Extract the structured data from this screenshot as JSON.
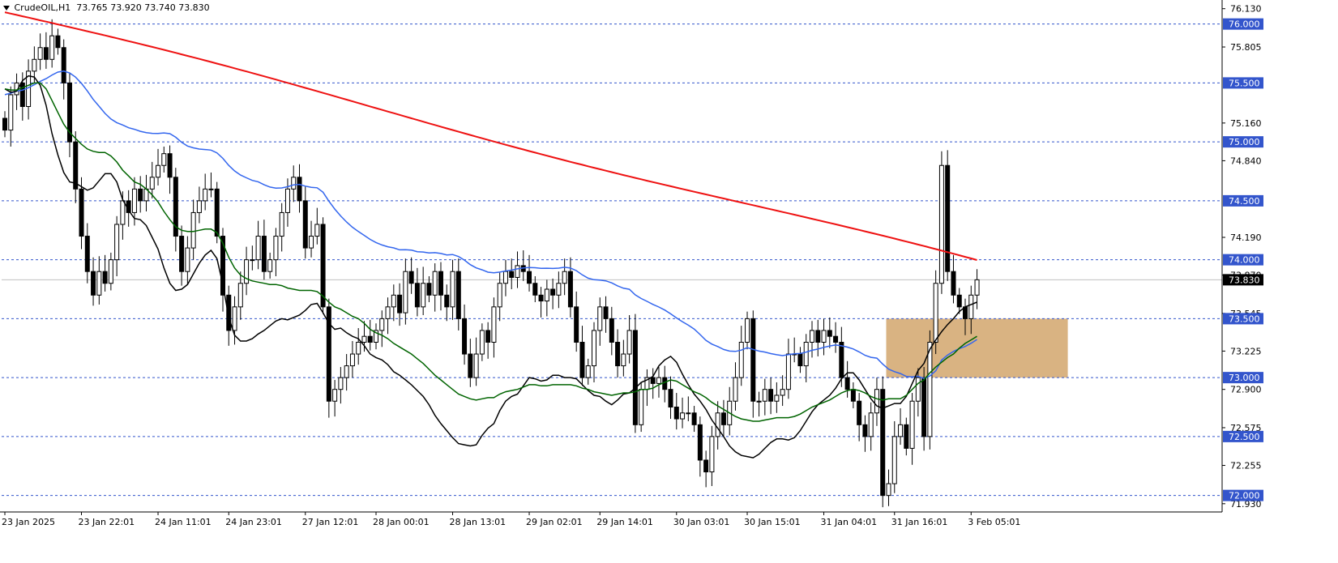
{
  "header": {
    "symbol": "CrudeOIL,H1",
    "ohlc": "73.765 73.920 73.740 73.830"
  },
  "colors": {
    "bull": "#ffffff",
    "bear": "#000000",
    "ma_fast": "#000000",
    "ma_mid": "#006400",
    "ma_slow": "#3366ee",
    "ma_long": "#ee1111",
    "level_line": "#3355cc",
    "level_badge": "#3355cc",
    "zone": "#d9b382",
    "price_line": "#c0c0c0"
  },
  "chart_data": {
    "type": "candlestick",
    "title": "",
    "xlabel": "",
    "ylabel": "",
    "ylim": [
      71.86,
      76.19
    ],
    "grid": false,
    "y_ticks": [
      "76.130",
      "75.805",
      "75.160",
      "74.840",
      "74.190",
      "73.870",
      "73.545",
      "73.225",
      "72.900",
      "72.575",
      "72.255",
      "71.930"
    ],
    "y_tick_values": [
      76.13,
      75.805,
      75.16,
      74.84,
      74.19,
      73.87,
      73.545,
      73.225,
      72.9,
      72.575,
      72.255,
      71.93
    ],
    "x_ticks": [
      "23 Jan 2025",
      "23 Jan 22:01",
      "24 Jan 11:01",
      "24 Jan 23:01",
      "27 Jan 12:01",
      "28 Jan 00:01",
      "28 Jan 13:01",
      "29 Jan 02:01",
      "29 Jan 14:01",
      "30 Jan 03:01",
      "30 Jan 15:01",
      "31 Jan 04:01",
      "31 Jan 16:01",
      "3 Feb 05:01"
    ],
    "x_tick_index": [
      0,
      13,
      26,
      38,
      51,
      63,
      76,
      89,
      101,
      114,
      126,
      139,
      151,
      164
    ],
    "levels": [
      {
        "label": "76.000",
        "value": 76.0
      },
      {
        "label": "75.500",
        "value": 75.5
      },
      {
        "label": "75.000",
        "value": 75.0
      },
      {
        "label": "74.500",
        "value": 74.5
      },
      {
        "label": "74.000",
        "value": 74.0
      },
      {
        "label": "73.500",
        "value": 73.5
      },
      {
        "label": "73.000",
        "value": 73.0
      },
      {
        "label": "72.500",
        "value": 72.5
      },
      {
        "label": "72.000",
        "value": 72.0
      }
    ],
    "current_price": {
      "label": "73.830",
      "value": 73.83
    },
    "zone": {
      "from_index": 150,
      "to_index": 180,
      "low": 73.0,
      "high": 73.5
    },
    "close": [
      75.1,
      75.4,
      75.5,
      75.3,
      75.6,
      75.7,
      75.8,
      75.7,
      75.9,
      75.8,
      75.5,
      75.0,
      74.6,
      74.2,
      73.9,
      73.7,
      73.9,
      73.8,
      74.0,
      74.3,
      74.5,
      74.4,
      74.6,
      74.5,
      74.6,
      74.7,
      74.8,
      74.9,
      74.7,
      74.2,
      73.9,
      74.1,
      74.4,
      74.5,
      74.6,
      74.6,
      74.2,
      73.7,
      73.4,
      73.6,
      73.8,
      74.0,
      74.0,
      74.2,
      73.9,
      74.0,
      74.2,
      74.4,
      74.6,
      74.7,
      74.5,
      74.1,
      74.2,
      74.3,
      73.6,
      72.8,
      72.9,
      73.0,
      73.1,
      73.2,
      73.3,
      73.35,
      73.3,
      73.4,
      73.5,
      73.6,
      73.7,
      73.55,
      73.9,
      73.8,
      73.6,
      73.8,
      73.7,
      73.9,
      73.7,
      73.6,
      73.9,
      73.5,
      73.2,
      73.0,
      73.2,
      73.4,
      73.3,
      73.6,
      73.8,
      73.9,
      73.85,
      73.95,
      73.9,
      73.8,
      73.7,
      73.65,
      73.75,
      73.7,
      73.8,
      73.9,
      73.6,
      73.3,
      73.0,
      73.1,
      73.4,
      73.6,
      73.5,
      73.3,
      73.1,
      73.2,
      73.4,
      72.6,
      72.9,
      73.0,
      72.95,
      73.0,
      72.9,
      72.75,
      72.65,
      72.7,
      72.7,
      72.6,
      72.3,
      72.2,
      72.5,
      72.7,
      72.6,
      72.8,
      73.0,
      73.3,
      73.5,
      72.8,
      72.8,
      72.9,
      72.8,
      72.85,
      72.9,
      73.2,
      73.2,
      73.1,
      73.3,
      73.4,
      73.3,
      73.4,
      73.35,
      73.3,
      73.0,
      72.9,
      72.8,
      72.6,
      72.5,
      72.7,
      72.9,
      72.0,
      72.1,
      72.5,
      72.6,
      72.4,
      72.8,
      73.0,
      72.5,
      73.3,
      73.8,
      74.8,
      73.9,
      73.7,
      73.6,
      73.5,
      73.7,
      73.83
    ],
    "series": [
      {
        "key": "ma_fast",
        "values": [
          75.45,
          75.42,
          75.43,
          75.52,
          75.56,
          75.55,
          75.48,
          75.31,
          75.07,
          74.89,
          74.74,
          74.66,
          74.65,
          74.62,
          74.59,
          74.61,
          74.67,
          74.73,
          74.73,
          74.66,
          74.51,
          74.42,
          74.35,
          74.34,
          74.29,
          74.19,
          74.09,
          73.93,
          73.8,
          73.74,
          73.75,
          73.79,
          73.88,
          73.97,
          74.04,
          74.08,
          74.01,
          73.79,
          73.51,
          73.36,
          73.31,
          73.31,
          73.33,
          73.37,
          73.4,
          73.44,
          73.48,
          73.5,
          73.49,
          73.51,
          73.53,
          73.57,
          73.62,
          73.63,
          73.55,
          73.46,
          73.41,
          73.42,
          73.38,
          73.35,
          73.33,
          73.27,
          73.2,
          73.17,
          73.15,
          73.11,
          73.05,
          73.02,
          72.98,
          72.94,
          72.89,
          72.84,
          72.77,
          72.68,
          72.61,
          72.55,
          72.49,
          72.44,
          72.43,
          72.42,
          72.43,
          72.51,
          72.57,
          72.61,
          72.72,
          72.8,
          72.84,
          72.86,
          72.93,
          73.0,
          72.99,
          72.97,
          72.98,
          73.02,
          73.02,
          73.0,
          73.0,
          72.99,
          72.94,
          72.89,
          72.85,
          72.84,
          72.8,
          72.77,
          72.81,
          72.86,
          72.87,
          72.91,
          72.96,
          72.98,
          73.01,
          73.1,
          73.15,
          73.18,
          73.13,
          73.03,
          72.94,
          72.86,
          72.8,
          72.73,
          72.64,
          72.57,
          72.5,
          72.42,
          72.37,
          72.34,
          72.33,
          72.32,
          72.35,
          72.4,
          72.45,
          72.48,
          72.48,
          72.47,
          72.49,
          72.55,
          72.63,
          72.71,
          72.77,
          72.81,
          72.85,
          72.91,
          72.99,
          73.04,
          73.04,
          72.98,
          72.9,
          72.82,
          72.76,
          72.74,
          72.76,
          72.78,
          72.78,
          72.84,
          72.95,
          73.06,
          73.12,
          73.24,
          73.32,
          73.39,
          73.45,
          73.5,
          73.56,
          73.6,
          73.62,
          73.64
        ]
      },
      {
        "key": "ma_mid",
        "values": [
          75.45,
          75.44,
          75.44,
          75.46,
          75.48,
          75.5,
          75.5,
          75.45,
          75.35,
          75.25,
          75.15,
          75.08,
          75.03,
          74.98,
          74.94,
          74.92,
          74.91,
          74.91,
          74.88,
          74.83,
          74.76,
          74.71,
          74.66,
          74.64,
          74.6,
          74.55,
          74.49,
          74.41,
          74.34,
          74.28,
          74.25,
          74.24,
          74.24,
          74.25,
          74.26,
          74.26,
          74.23,
          74.14,
          74.02,
          73.93,
          73.87,
          73.84,
          73.82,
          73.81,
          73.8,
          73.79,
          73.79,
          73.78,
          73.76,
          73.75,
          73.74,
          73.74,
          73.74,
          73.73,
          73.69,
          73.64,
          73.6,
          73.58,
          73.55,
          73.52,
          73.5,
          73.46,
          73.41,
          73.38,
          73.36,
          73.33,
          73.29,
          73.26,
          73.23,
          73.2,
          73.16,
          73.12,
          73.07,
          73.02,
          72.98,
          72.94,
          72.9,
          72.86,
          72.84,
          72.82,
          72.81,
          72.82,
          72.83,
          72.83,
          72.86,
          72.88,
          72.89,
          72.9,
          72.92,
          72.94,
          72.94,
          72.93,
          72.93,
          72.94,
          72.94,
          72.94,
          72.94,
          72.93,
          72.91,
          72.9,
          72.88,
          72.87,
          72.86,
          72.85,
          72.86,
          72.87,
          72.87,
          72.88,
          72.9,
          72.9,
          72.91,
          72.94,
          72.96,
          72.98,
          72.97,
          72.94,
          72.91,
          72.88,
          72.86,
          72.83,
          72.79,
          72.76,
          72.73,
          72.7,
          72.67,
          72.65,
          72.64,
          72.63,
          72.63,
          72.64,
          72.65,
          72.66,
          72.66,
          72.66,
          72.67,
          72.69,
          72.72,
          72.75,
          72.77,
          72.79,
          72.81,
          72.84,
          72.87,
          72.89,
          72.9,
          72.89,
          72.87,
          72.84,
          72.82,
          72.81,
          72.82,
          72.82,
          72.82,
          72.85,
          72.9,
          72.95,
          72.98,
          73.04,
          73.09,
          73.13,
          73.17,
          73.2,
          73.25,
          73.29,
          73.32,
          73.35
        ]
      }
    ]
  }
}
